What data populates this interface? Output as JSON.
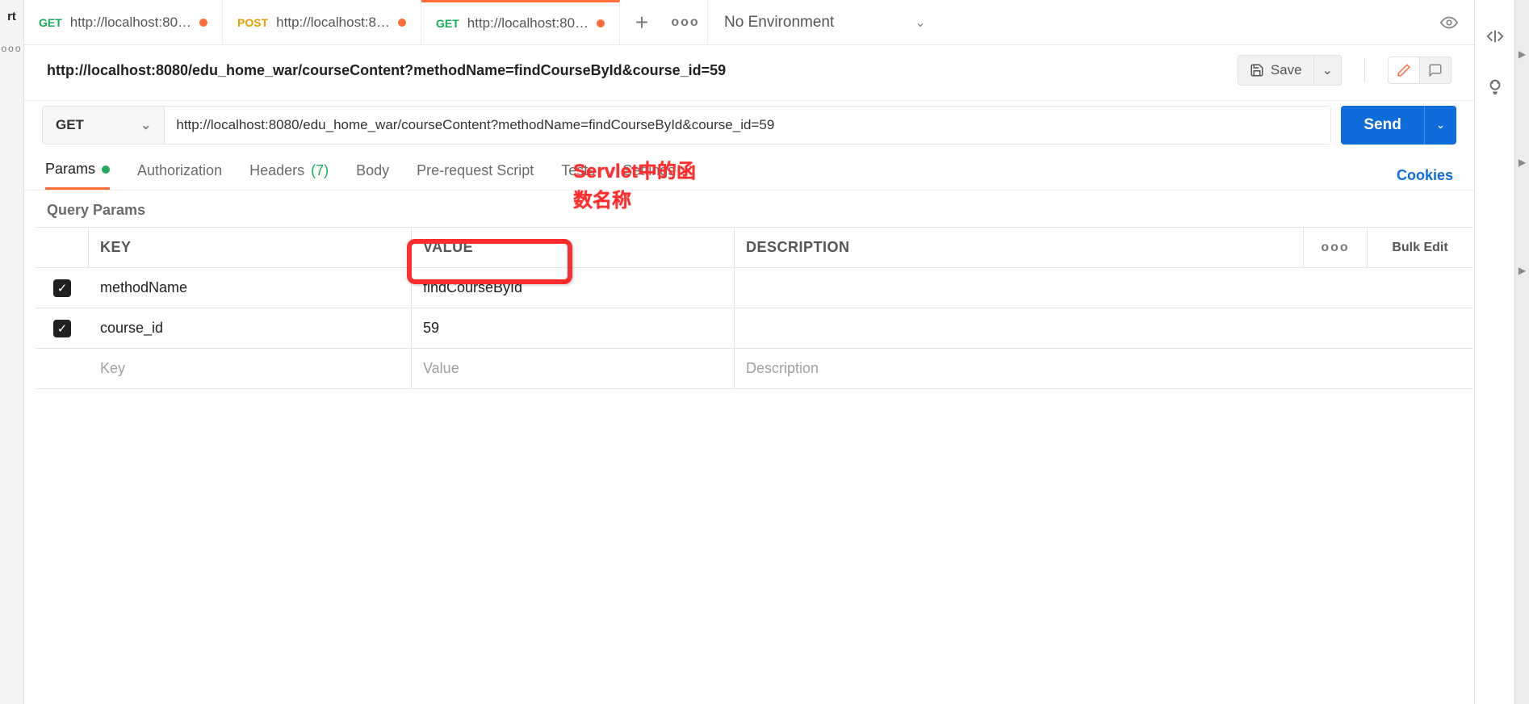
{
  "tabs": [
    {
      "method": "GET",
      "title": "http://localhost:80…",
      "dirty": true,
      "active": false,
      "methodClass": "method-get"
    },
    {
      "method": "POST",
      "title": "http://localhost:8…",
      "dirty": true,
      "active": false,
      "methodClass": "method-post"
    },
    {
      "method": "GET",
      "title": "http://localhost:80…",
      "dirty": true,
      "active": true,
      "methodClass": "method-get"
    }
  ],
  "env": {
    "label": "No Environment"
  },
  "request": {
    "title": "http://localhost:8080/edu_home_war/courseContent?methodName=findCourseById&course_id=59",
    "method": "GET",
    "url": "http://localhost:8080/edu_home_war/courseContent?methodName=findCourseById&course_id=59",
    "save_label": "Save",
    "send_label": "Send"
  },
  "subtabs": {
    "params": "Params",
    "authorization": "Authorization",
    "headers": "Headers",
    "headers_count": "(7)",
    "body": "Body",
    "prerequest": "Pre-request Script",
    "tests": "Tests",
    "settings": "Settings",
    "cookies": "Cookies"
  },
  "section": {
    "query_params": "Query Params"
  },
  "table": {
    "head": {
      "key": "KEY",
      "value": "VALUE",
      "description": "DESCRIPTION",
      "bulk": "Bulk Edit"
    },
    "rows": [
      {
        "checked": true,
        "key": "methodName",
        "value": "findCourseById",
        "description": ""
      },
      {
        "checked": true,
        "key": "course_id",
        "value": "59",
        "description": ""
      }
    ],
    "placeholder": {
      "key": "Key",
      "value": "Value",
      "description": "Description"
    }
  },
  "annotation": {
    "line1": "Servlet中的函",
    "line2": "数名称"
  },
  "left_rail": {
    "rt": "rt"
  }
}
